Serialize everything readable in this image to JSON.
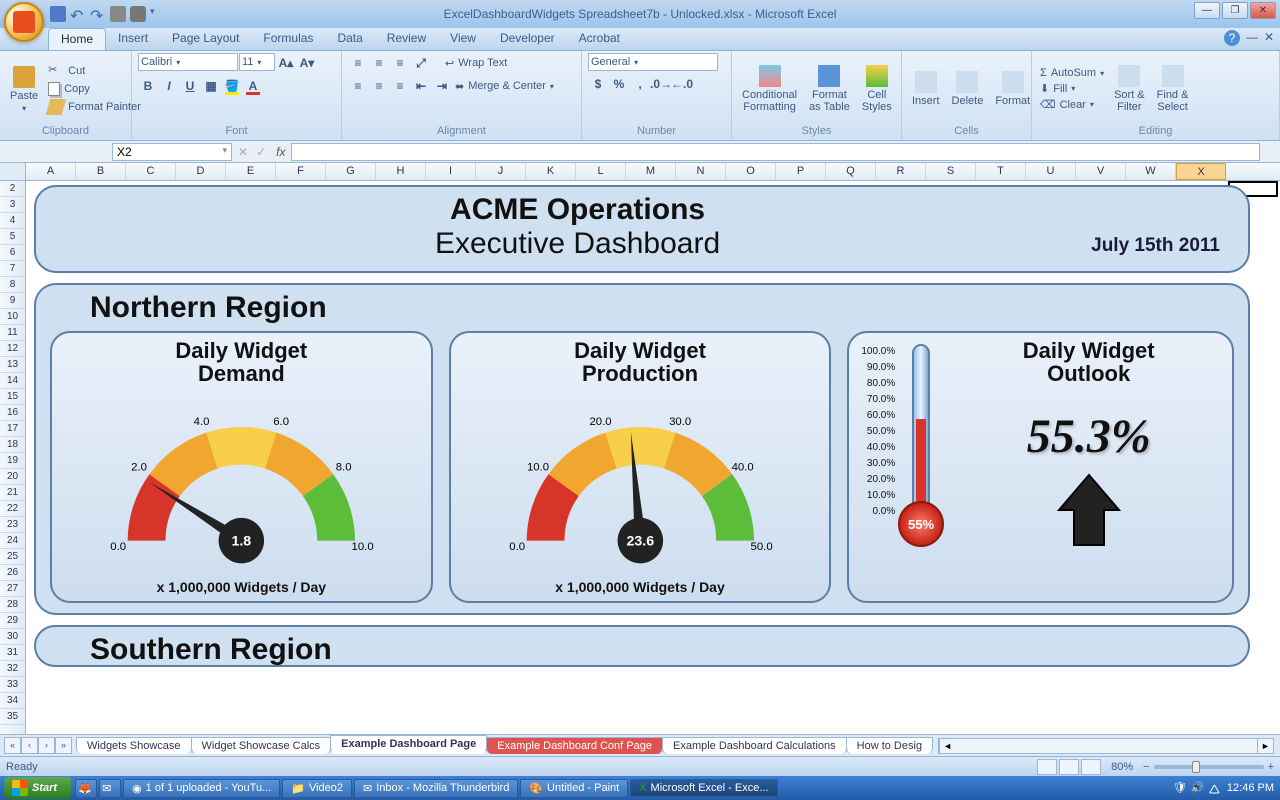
{
  "app": {
    "title": "ExcelDashboardWidgets Spreadsheet7b - Unlocked.xlsx - Microsoft Excel"
  },
  "ribbon": {
    "tabs": [
      "Home",
      "Insert",
      "Page Layout",
      "Formulas",
      "Data",
      "Review",
      "View",
      "Developer",
      "Acrobat"
    ],
    "active_tab": "Home",
    "clipboard": {
      "paste": "Paste",
      "cut": "Cut",
      "copy": "Copy",
      "painter": "Format Painter",
      "label": "Clipboard"
    },
    "font": {
      "name": "Calibri",
      "size": "11",
      "label": "Font"
    },
    "alignment": {
      "wrap": "Wrap Text",
      "merge": "Merge & Center",
      "label": "Alignment"
    },
    "number": {
      "format": "General",
      "label": "Number"
    },
    "styles": {
      "cond": "Conditional\nFormatting",
      "table": "Format\nas Table",
      "cell": "Cell\nStyles",
      "label": "Styles"
    },
    "cells": {
      "insert": "Insert",
      "delete": "Delete",
      "format": "Format",
      "label": "Cells"
    },
    "editing": {
      "autosum": "AutoSum",
      "fill": "Fill",
      "clear": "Clear",
      "sort": "Sort &\nFilter",
      "find": "Find &\nSelect",
      "label": "Editing"
    }
  },
  "formula_bar": {
    "name_box": "X2",
    "fx": "fx"
  },
  "columns": [
    "A",
    "B",
    "C",
    "D",
    "E",
    "F",
    "G",
    "H",
    "I",
    "J",
    "K",
    "L",
    "M",
    "N",
    "O",
    "P",
    "Q",
    "R",
    "S",
    "T",
    "U",
    "V",
    "W",
    "X"
  ],
  "rows": [
    "2",
    "3",
    "4",
    "5",
    "6",
    "7",
    "8",
    "9",
    "10",
    "11",
    "12",
    "13",
    "14",
    "15",
    "16",
    "17",
    "18",
    "19",
    "20",
    "21",
    "22",
    "23",
    "24",
    "25",
    "26",
    "27",
    "28",
    "29",
    "30",
    "31",
    "32",
    "33",
    "34",
    "35"
  ],
  "dashboard": {
    "title1": "ACME Operations",
    "title2": "Executive Dashboard",
    "date": "July 15th 2011",
    "region1": "Northern Region",
    "region2": "Southern Region",
    "card1": {
      "title": "Daily Widget\nDemand",
      "value": "1.8",
      "footer": "x 1,000,000 Widgets / Day",
      "ticks": [
        "0.0",
        "2.0",
        "4.0",
        "6.0",
        "8.0",
        "10.0"
      ]
    },
    "card2": {
      "title": "Daily Widget\nProduction",
      "value": "23.6",
      "footer": "x 1,000,000 Widgets / Day",
      "ticks": [
        "0.0",
        "10.0",
        "20.0",
        "30.0",
        "40.0",
        "50.0"
      ]
    },
    "card3": {
      "title": "Daily Widget\nOutlook",
      "pct": "55.3%",
      "bulb": "55%",
      "scale": [
        "100.0%",
        "90.0%",
        "80.0%",
        "70.0%",
        "60.0%",
        "50.0%",
        "40.0%",
        "30.0%",
        "20.0%",
        "10.0%",
        "0.0%"
      ]
    }
  },
  "sheet_tabs": [
    "Widgets Showcase",
    "Widget Showcase Calcs",
    "Example Dashboard Page",
    "Example Dashboard Conf Page",
    "Example Dashboard Calculations",
    "How to Desig"
  ],
  "active_sheet": "Example Dashboard Page",
  "status": {
    "ready": "Ready",
    "zoom": "80%"
  },
  "taskbar": {
    "start": "Start",
    "items": [
      "1 of 1 uploaded - YouTu...",
      "Video2",
      "Inbox - Mozilla Thunderbird",
      "Untitled - Paint",
      "Microsoft Excel - Exce..."
    ],
    "time": "12:46 PM"
  },
  "chart_data": [
    {
      "type": "gauge",
      "title": "Daily Widget Demand",
      "value": 1.8,
      "min": 0,
      "max": 10,
      "ticks": [
        0,
        2,
        4,
        6,
        8,
        10
      ],
      "zones": [
        {
          "from": 0,
          "to": 2,
          "color": "#d8352a"
        },
        {
          "from": 2,
          "to": 4,
          "color": "#f0a62f"
        },
        {
          "from": 4,
          "to": 6,
          "color": "#f7cf4a"
        },
        {
          "from": 6,
          "to": 8,
          "color": "#f0a62f"
        },
        {
          "from": 8,
          "to": 10,
          "color": "#5bbd3a"
        }
      ],
      "unit": "x 1,000,000 Widgets / Day"
    },
    {
      "type": "gauge",
      "title": "Daily Widget Production",
      "value": 23.6,
      "min": 0,
      "max": 50,
      "ticks": [
        0,
        10,
        20,
        30,
        40,
        50
      ],
      "zones": [
        {
          "from": 0,
          "to": 10,
          "color": "#d8352a"
        },
        {
          "from": 10,
          "to": 20,
          "color": "#f0a62f"
        },
        {
          "from": 20,
          "to": 30,
          "color": "#f7cf4a"
        },
        {
          "from": 30,
          "to": 40,
          "color": "#f0a62f"
        },
        {
          "from": 40,
          "to": 50,
          "color": "#5bbd3a"
        }
      ],
      "unit": "x 1,000,000 Widgets / Day"
    },
    {
      "type": "thermometer",
      "title": "Daily Widget Outlook",
      "value": 55.3,
      "min": 0,
      "max": 100,
      "unit": "%",
      "trend": "up"
    }
  ]
}
